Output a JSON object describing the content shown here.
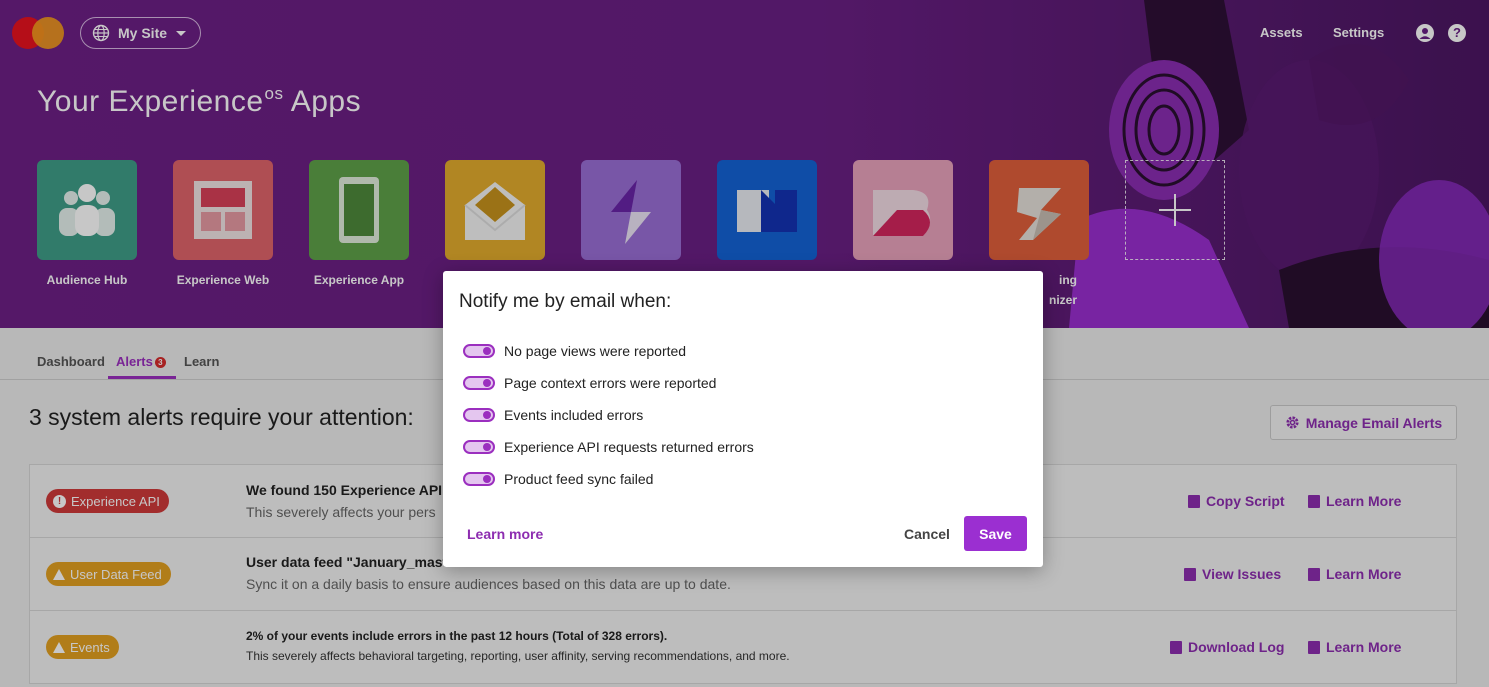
{
  "header": {
    "site_selector": "My Site",
    "links": {
      "assets": "Assets",
      "settings": "Settings"
    },
    "icons": [
      "globe-icon",
      "user-icon",
      "help-icon"
    ]
  },
  "hero": {
    "title": "Your Experience",
    "title_sup": "os",
    "title_end": " Apps",
    "apps": [
      {
        "label": "Audience Hub",
        "color": "#3f9e88"
      },
      {
        "label": "Experience Web",
        "color": "#e0646b"
      },
      {
        "label": "Experience App",
        "color": "#5fa24a"
      },
      {
        "label": "",
        "color": "#e3ac2e"
      },
      {
        "label": "",
        "color": "#9a6fd6"
      },
      {
        "label": "",
        "color": "#1463d6"
      },
      {
        "label": "",
        "color": "#e9a3bd"
      },
      {
        "label": "ing",
        "label2": "nizer",
        "color": "#e15f3c"
      }
    ]
  },
  "tabs": {
    "dashboard": "Dashboard",
    "alerts": "Alerts",
    "alerts_count": "3",
    "learn": "Learn"
  },
  "alerts": {
    "heading": "3 system alerts require your attention:",
    "manage_button": "Manage Email Alerts",
    "items": [
      {
        "badge": "Experience API",
        "title": "We found 150 Experience API",
        "description": "This severely affects your pers",
        "action1": "Copy Script",
        "action2": "Learn More"
      },
      {
        "badge": "User Data Feed",
        "title": "User data feed \"January_mast",
        "description": "Sync it on a daily basis to ensure audiences based on this data are up to date.",
        "action1": "View Issues",
        "action2": "Learn More"
      },
      {
        "badge": "Events",
        "title": "2% of your events include errors in the past 12 hours (Total of 328 errors).",
        "description": "This severely affects behavioral targeting, reporting, user affinity, serving recommendations, and more.",
        "action1": "Download Log",
        "action2": "Learn More"
      }
    ]
  },
  "modal": {
    "title": "Notify me by email when:",
    "options": [
      "No page views were reported",
      "Page context errors were reported",
      "Events included errors",
      "Experience API requests returned errors",
      "Product feed sync failed"
    ],
    "learn_more": "Learn more",
    "cancel": "Cancel",
    "save": "Save"
  },
  "colors": {
    "accent": "#9b2fbf",
    "hero": "#6d1f86",
    "error": "#d03a3a",
    "warning": "#e3a020"
  }
}
